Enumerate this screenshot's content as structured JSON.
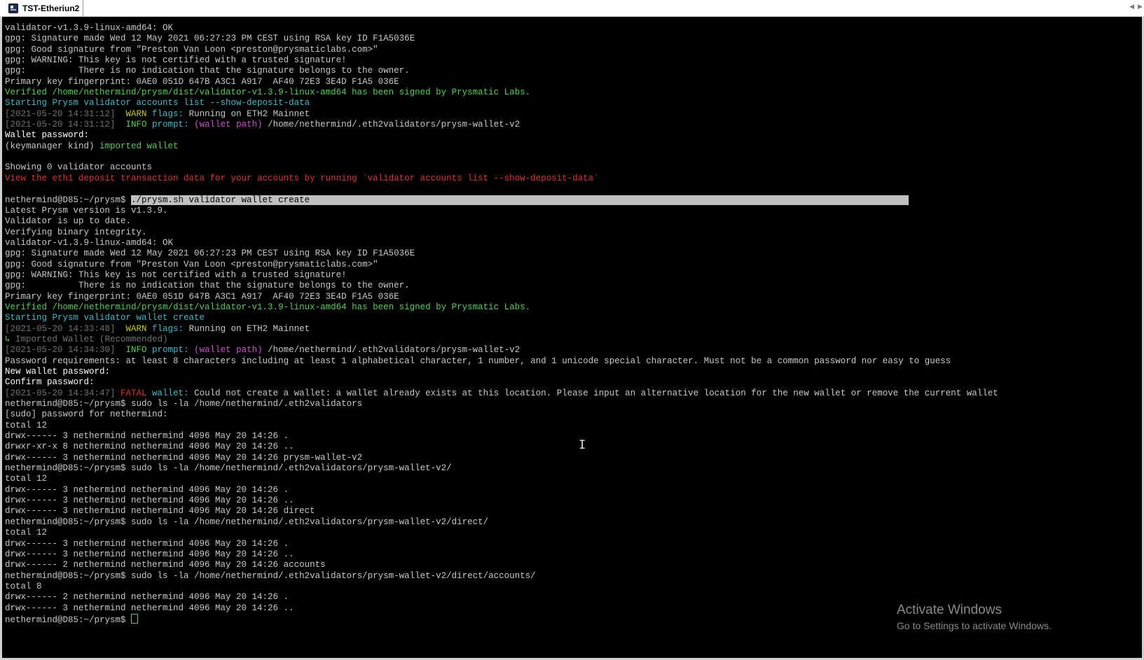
{
  "tab": {
    "title": "TST-Etheriun2",
    "icon": "terminal-app-icon"
  },
  "terminal": {
    "lines": [
      {
        "segs": [
          {
            "t": "validator-v1.3.9-linux-amd64: OK",
            "c": ""
          }
        ]
      },
      {
        "segs": [
          {
            "t": "gpg: Signature made Wed 12 May 2021 06:27:23 PM CEST using RSA key ID F1A5036E",
            "c": ""
          }
        ]
      },
      {
        "segs": [
          {
            "t": "gpg: Good signature from \"Preston Van Loon <preston@prysmaticlabs.com>\"",
            "c": ""
          }
        ]
      },
      {
        "segs": [
          {
            "t": "gpg: WARNING: This key is not certified with a trusted signature!",
            "c": ""
          }
        ]
      },
      {
        "segs": [
          {
            "t": "gpg:          There is no indication that the signature belongs to the owner.",
            "c": ""
          }
        ]
      },
      {
        "segs": [
          {
            "t": "Primary key fingerprint: 0AE0 051D 647B A3C1 A917  AF40 72E3 3E4D F1A5 036E",
            "c": ""
          }
        ]
      },
      {
        "segs": [
          {
            "t": "Verified /home/nethermind/prysm/dist/validator-v1.3.9-linux-amd64 has been signed by Prysmatic Labs.",
            "c": "green"
          }
        ]
      },
      {
        "segs": [
          {
            "t": "Starting Prysm validator accounts list --show-deposit-data",
            "c": "cyan"
          }
        ]
      },
      {
        "segs": [
          {
            "t": "[2021-05-20 14:31:12]",
            "c": "grey"
          },
          {
            "t": "  WARN ",
            "c": "yellow"
          },
          {
            "t": "flags:",
            "c": "cyan"
          },
          {
            "t": " Running on ETH2 Mainnet",
            "c": ""
          }
        ]
      },
      {
        "segs": [
          {
            "t": "[2021-05-20 14:31:12]",
            "c": "grey"
          },
          {
            "t": "  INFO ",
            "c": "green"
          },
          {
            "t": "prompt:",
            "c": "cyan"
          },
          {
            "t": " (wallet path)",
            "c": "magenta"
          },
          {
            "t": " /home/nethermind/.eth2validators/prysm-wallet-v2",
            "c": ""
          }
        ]
      },
      {
        "segs": [
          {
            "t": "Wallet password:",
            "c": "bright"
          }
        ]
      },
      {
        "segs": [
          {
            "t": "(keymanager kind) ",
            "c": ""
          },
          {
            "t": "imported wallet",
            "c": "green"
          }
        ]
      },
      {
        "segs": [
          {
            "t": "",
            "c": ""
          }
        ]
      },
      {
        "segs": [
          {
            "t": "Showing 0 validator accounts",
            "c": ""
          }
        ]
      },
      {
        "segs": [
          {
            "t": "View the eth1 deposit transaction data for your accounts by running `validator accounts list --show-deposit-data`",
            "c": "red"
          }
        ]
      },
      {
        "segs": [
          {
            "t": "",
            "c": ""
          }
        ]
      },
      {
        "segs": [
          {
            "t": "nethermind@D85:~/prysm$ ",
            "c": ""
          },
          {
            "t": "./prysm.sh validator wallet create                                                                                                                  ",
            "c": "highlight"
          }
        ]
      },
      {
        "segs": [
          {
            "t": "Latest Prysm version is v1.3.9.",
            "c": ""
          }
        ]
      },
      {
        "segs": [
          {
            "t": "Validator is up to date.",
            "c": ""
          }
        ]
      },
      {
        "segs": [
          {
            "t": "Verifying binary integrity.",
            "c": ""
          }
        ]
      },
      {
        "segs": [
          {
            "t": "validator-v1.3.9-linux-amd64: OK",
            "c": ""
          }
        ]
      },
      {
        "segs": [
          {
            "t": "gpg: Signature made Wed 12 May 2021 06:27:23 PM CEST using RSA key ID F1A5036E",
            "c": ""
          }
        ]
      },
      {
        "segs": [
          {
            "t": "gpg: Good signature from \"Preston Van Loon <preston@prysmaticlabs.com>\"",
            "c": ""
          }
        ]
      },
      {
        "segs": [
          {
            "t": "gpg: WARNING: This key is not certified with a trusted signature!",
            "c": ""
          }
        ]
      },
      {
        "segs": [
          {
            "t": "gpg:          There is no indication that the signature belongs to the owner.",
            "c": ""
          }
        ]
      },
      {
        "segs": [
          {
            "t": "Primary key fingerprint: 0AE0 051D 647B A3C1 A917  AF40 72E3 3E4D F1A5 036E",
            "c": ""
          }
        ]
      },
      {
        "segs": [
          {
            "t": "Verified /home/nethermind/prysm/dist/validator-v1.3.9-linux-amd64 has been signed by Prysmatic Labs.",
            "c": "green"
          }
        ]
      },
      {
        "segs": [
          {
            "t": "Starting Prysm validator wallet create",
            "c": "cyan"
          }
        ]
      },
      {
        "segs": [
          {
            "t": "[2021-05-20 14:33:48]",
            "c": "grey"
          },
          {
            "t": "  WARN ",
            "c": "yellow"
          },
          {
            "t": "flags:",
            "c": "cyan"
          },
          {
            "t": " Running on ETH2 Mainnet",
            "c": ""
          }
        ]
      },
      {
        "segs": [
          {
            "t": "↳",
            "c": "green"
          },
          {
            "t": " Imported Wallet (Recommended)",
            "c": "grey"
          }
        ]
      },
      {
        "segs": [
          {
            "t": "[2021-05-20 14:34:30]",
            "c": "grey"
          },
          {
            "t": "  INFO ",
            "c": "green"
          },
          {
            "t": "prompt:",
            "c": "cyan"
          },
          {
            "t": " (wallet path)",
            "c": "magenta"
          },
          {
            "t": " /home/nethermind/.eth2validators/prysm-wallet-v2",
            "c": ""
          }
        ]
      },
      {
        "segs": [
          {
            "t": "Password requirements: at least 8 characters including at least 1 alphabetical character, 1 number, and 1 unicode special character. Must not be a common password nor easy to guess",
            "c": ""
          }
        ]
      },
      {
        "segs": [
          {
            "t": "New wallet password:",
            "c": "bright"
          }
        ]
      },
      {
        "segs": [
          {
            "t": "Confirm password:",
            "c": "bright"
          }
        ]
      },
      {
        "segs": [
          {
            "t": "[2021-05-20 14:34:47]",
            "c": "grey"
          },
          {
            "t": " FATAL ",
            "c": "red"
          },
          {
            "t": "wallet:",
            "c": "cyan"
          },
          {
            "t": " Could not create a wallet: a wallet already exists at this location. Please input an alternative location for the new wallet or remove the current wallet",
            "c": ""
          }
        ]
      },
      {
        "segs": [
          {
            "t": "nethermind@D85:~/prysm$ sudo ls -la /home/nethermind/.eth2validators",
            "c": ""
          }
        ]
      },
      {
        "segs": [
          {
            "t": "[sudo] password for nethermind:",
            "c": ""
          }
        ]
      },
      {
        "segs": [
          {
            "t": "total 12",
            "c": ""
          }
        ]
      },
      {
        "segs": [
          {
            "t": "drwx------ 3 nethermind nethermind 4096 May 20 14:26 .",
            "c": ""
          }
        ]
      },
      {
        "segs": [
          {
            "t": "drwxr-xr-x 8 nethermind nethermind 4096 May 20 14:26 ..",
            "c": ""
          }
        ]
      },
      {
        "segs": [
          {
            "t": "drwx------ 3 nethermind nethermind 4096 May 20 14:26 prysm-wallet-v2",
            "c": ""
          }
        ]
      },
      {
        "segs": [
          {
            "t": "nethermind@D85:~/prysm$ sudo ls -la /home/nethermind/.eth2validators/prysm-wallet-v2/",
            "c": ""
          }
        ]
      },
      {
        "segs": [
          {
            "t": "total 12",
            "c": ""
          }
        ]
      },
      {
        "segs": [
          {
            "t": "drwx------ 3 nethermind nethermind 4096 May 20 14:26 .",
            "c": ""
          }
        ]
      },
      {
        "segs": [
          {
            "t": "drwx------ 3 nethermind nethermind 4096 May 20 14:26 ..",
            "c": ""
          }
        ]
      },
      {
        "segs": [
          {
            "t": "drwx------ 3 nethermind nethermind 4096 May 20 14:26 direct",
            "c": ""
          }
        ]
      },
      {
        "segs": [
          {
            "t": "nethermind@D85:~/prysm$ sudo ls -la /home/nethermind/.eth2validators/prysm-wallet-v2/direct/",
            "c": ""
          }
        ]
      },
      {
        "segs": [
          {
            "t": "total 12",
            "c": ""
          }
        ]
      },
      {
        "segs": [
          {
            "t": "drwx------ 3 nethermind nethermind 4096 May 20 14:26 .",
            "c": ""
          }
        ]
      },
      {
        "segs": [
          {
            "t": "drwx------ 3 nethermind nethermind 4096 May 20 14:26 ..",
            "c": ""
          }
        ]
      },
      {
        "segs": [
          {
            "t": "drwx------ 2 nethermind nethermind 4096 May 20 14:26 accounts",
            "c": ""
          }
        ]
      },
      {
        "segs": [
          {
            "t": "nethermind@D85:~/prysm$ sudo ls -la /home/nethermind/.eth2validators/prysm-wallet-v2/direct/accounts/",
            "c": ""
          }
        ]
      },
      {
        "segs": [
          {
            "t": "total 8",
            "c": ""
          }
        ]
      },
      {
        "segs": [
          {
            "t": "drwx------ 2 nethermind nethermind 4096 May 20 14:26 .",
            "c": ""
          }
        ]
      },
      {
        "segs": [
          {
            "t": "drwx------ 3 nethermind nethermind 4096 May 20 14:26 ..",
            "c": ""
          }
        ]
      }
    ],
    "prompt": "nethermind@D85:~/prysm$ "
  },
  "watermark": {
    "title": "Activate Windows",
    "subtitle": "Go to Settings to activate Windows."
  },
  "colors": {
    "background": "#000000",
    "green": "#50d050",
    "cyan": "#3fb8c8",
    "red": "#e03030",
    "yellow": "#c8c820",
    "magenta": "#d050d0"
  }
}
